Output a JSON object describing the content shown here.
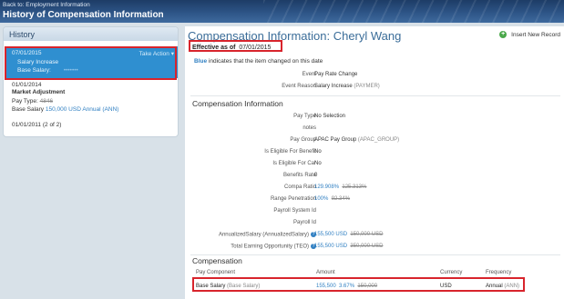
{
  "topbar": {
    "back_link": "Back to: Employment Information",
    "title": "History of Compensation Information"
  },
  "history": {
    "heading": "History",
    "selected": {
      "date": "07/01/2015",
      "action_label": "Take Action",
      "event": "Salary Increase",
      "base_label": "Base Salary:",
      "base_value": "•••••••"
    },
    "item2": {
      "date": "01/01/2014",
      "event": "Market Adjustment",
      "pay_type_label": "Pay Type:",
      "pay_type_old": "4846",
      "base_label": "Base Salary",
      "base_value": "150,000 USD Annual (ANN)"
    },
    "item3": {
      "date": "01/01/2011 (2 of 2)"
    }
  },
  "main": {
    "title": "Compensation Information: Cheryl Wang",
    "insert_label": "Insert New Record",
    "effective_label": "Effective as of",
    "effective_date": "07/01/2015",
    "legend_blue": "Blue",
    "legend_text": "indicates that the item changed on this date",
    "event": {
      "label": "Event",
      "value": "Pay Rate Change"
    },
    "event_reason": {
      "label": "Event Reason",
      "value": "Salary Increase",
      "code": "(PAYMER)"
    },
    "comp_section": "Compensation Information",
    "pay_type": {
      "label": "Pay Type",
      "value": "No Selection"
    },
    "notes": {
      "label": "notes",
      "value": ""
    },
    "pay_group": {
      "label": "Pay Group",
      "value": "APAC Pay Group",
      "code": "(APAC_GROUP)"
    },
    "eligible_benefit": {
      "label": "Is Eligible For Benefit",
      "value": "No"
    },
    "eligible_car": {
      "label": "Is Eligible For Car",
      "value": "No"
    },
    "benefits_rate": {
      "label": "Benefits Rate",
      "value": "0"
    },
    "compa_ratio": {
      "label": "Compa Ratio",
      "new": "129.908%",
      "old": "125.313%"
    },
    "range_penetration": {
      "label": "Range Penetration",
      "new": "100%",
      "old": "92.34%"
    },
    "payroll_system_id": {
      "label": "Payroll System Id",
      "value": ""
    },
    "payroll_id": {
      "label": "Payroll Id",
      "value": ""
    },
    "annualized_salary": {
      "label": "AnnualizedSalary (AnnualizedSalary)",
      "new": "155,500 USD",
      "old": "150,000 USD"
    },
    "teo": {
      "label": "Total Earning Opportunity (TEO)",
      "new": "155,500 USD",
      "old": "350,000 USD"
    },
    "compensation_section": "Compensation",
    "table": {
      "headers": [
        "Pay Component",
        "Amount",
        "Currency",
        "Frequency"
      ],
      "row": {
        "component": "Base Salary",
        "component_code": "(Base Salary)",
        "amount_new": "155,500",
        "amount_pct": "3.67%",
        "amount_old": "150,000",
        "currency": "USD",
        "frequency": "Annual",
        "frequency_code": "(ANN)"
      }
    }
  },
  "colors": {
    "header_blue": "#2d5486",
    "selected_blue": "#2f8fd0",
    "link_blue": "#2f7fc2",
    "highlight_red": "#d8242c"
  }
}
